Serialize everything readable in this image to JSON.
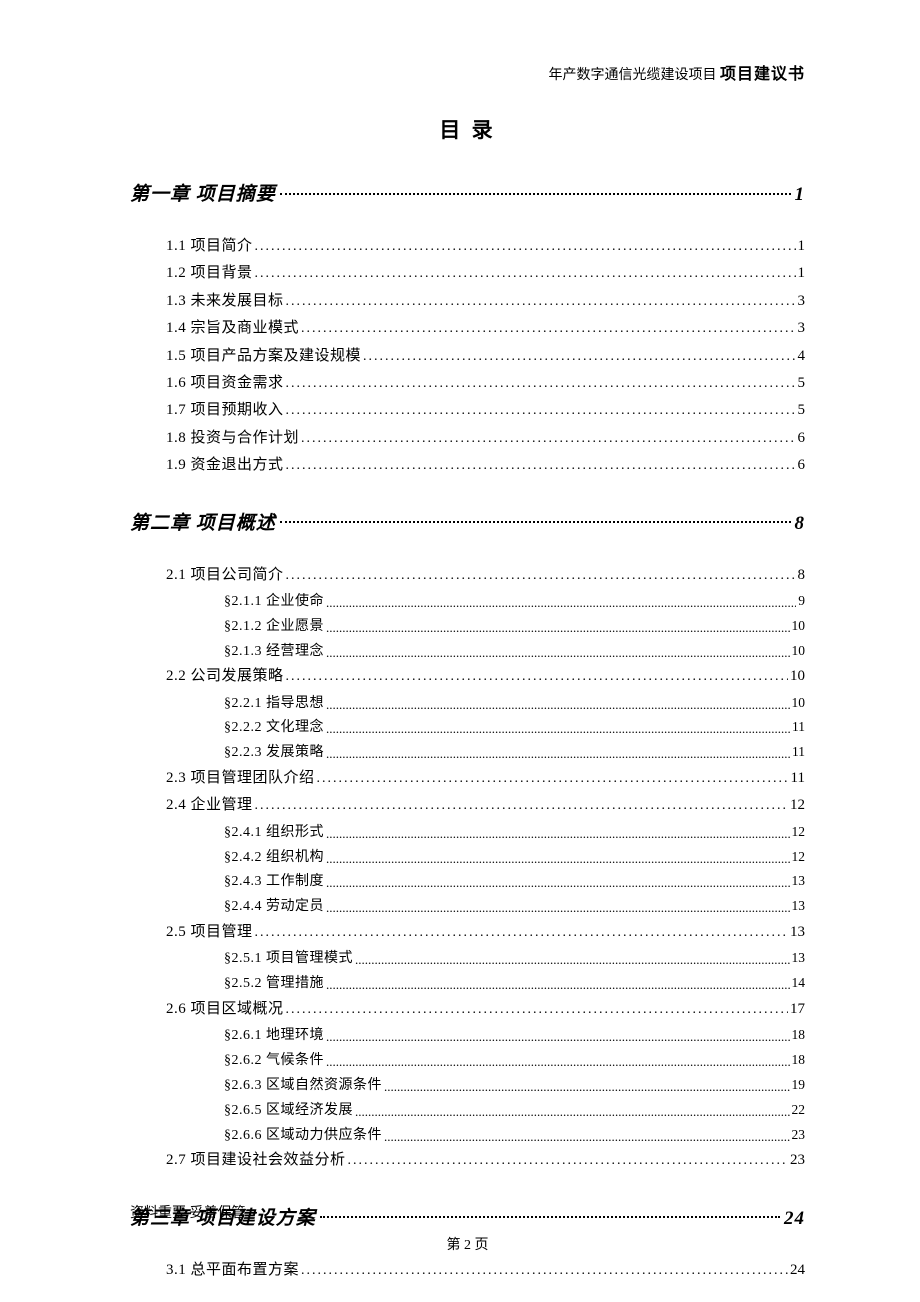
{
  "header": {
    "light": "年产数字通信光缆建设项目 ",
    "bold": "项目建议书"
  },
  "title": "目 录",
  "toc": [
    {
      "chapter": "第一章 项目摘要",
      "page": "1",
      "sections": [
        {
          "label": "1.1 项目简介",
          "page": "1"
        },
        {
          "label": "1.2 项目背景",
          "page": "1"
        },
        {
          "label": "1.3 未来发展目标",
          "page": "3"
        },
        {
          "label": "1.4 宗旨及商业模式",
          "page": "3"
        },
        {
          "label": "1.5 项目产品方案及建设规模",
          "page": "4"
        },
        {
          "label": "1.6 项目资金需求",
          "page": "5"
        },
        {
          "label": "1.7 项目预期收入",
          "page": "5"
        },
        {
          "label": "1.8 投资与合作计划",
          "page": "6"
        },
        {
          "label": "1.9 资金退出方式",
          "page": "6"
        }
      ]
    },
    {
      "chapter": "第二章 项目概述",
      "page": "8",
      "sections": [
        {
          "label": "2.1 项目公司简介",
          "page": "8",
          "subs": [
            {
              "label": "§2.1.1 企业使命",
              "page": "9"
            },
            {
              "label": "§2.1.2 企业愿景",
              "page": "10"
            },
            {
              "label": "§2.1.3 经营理念",
              "page": "10"
            }
          ]
        },
        {
          "label": "2.2 公司发展策略",
          "page": "10",
          "subs": [
            {
              "label": "§2.2.1 指导思想",
              "page": "10"
            },
            {
              "label": "§2.2.2 文化理念",
              "page": "11"
            },
            {
              "label": "§2.2.3 发展策略",
              "page": "11"
            }
          ]
        },
        {
          "label": "2.3 项目管理团队介绍",
          "page": "11"
        },
        {
          "label": "2.4 企业管理",
          "page": "12",
          "subs": [
            {
              "label": "§2.4.1 组织形式",
              "page": "12"
            },
            {
              "label": "§2.4.2 组织机构",
              "page": "12"
            },
            {
              "label": "§2.4.3 工作制度",
              "page": "13"
            },
            {
              "label": "§2.4.4 劳动定员",
              "page": "13"
            }
          ]
        },
        {
          "label": "2.5 项目管理",
          "page": "13",
          "subs": [
            {
              "label": "§2.5.1 项目管理模式",
              "page": "13"
            },
            {
              "label": "§2.5.2 管理措施",
              "page": "14"
            }
          ]
        },
        {
          "label": "2.6 项目区域概况",
          "page": "17",
          "subs": [
            {
              "label": "§2.6.1 地理环境",
              "page": "18"
            },
            {
              "label": "§2.6.2 气候条件",
              "page": "18"
            },
            {
              "label": "§2.6.3 区域自然资源条件",
              "page": "19"
            },
            {
              "label": "§2.6.5 区域经济发展",
              "page": "22"
            },
            {
              "label": "§2.6.6 区域动力供应条件",
              "page": "23"
            }
          ]
        },
        {
          "label": "2.7 项目建设社会效益分析",
          "page": "23"
        }
      ]
    },
    {
      "chapter": "第三章 项目建设方案",
      "page": "24",
      "sections": [
        {
          "label": "3.1 总平面布置方案",
          "page": "24"
        }
      ]
    }
  ],
  "footer": {
    "note": "资料重要 妥善保管",
    "page": "第 2 页"
  }
}
